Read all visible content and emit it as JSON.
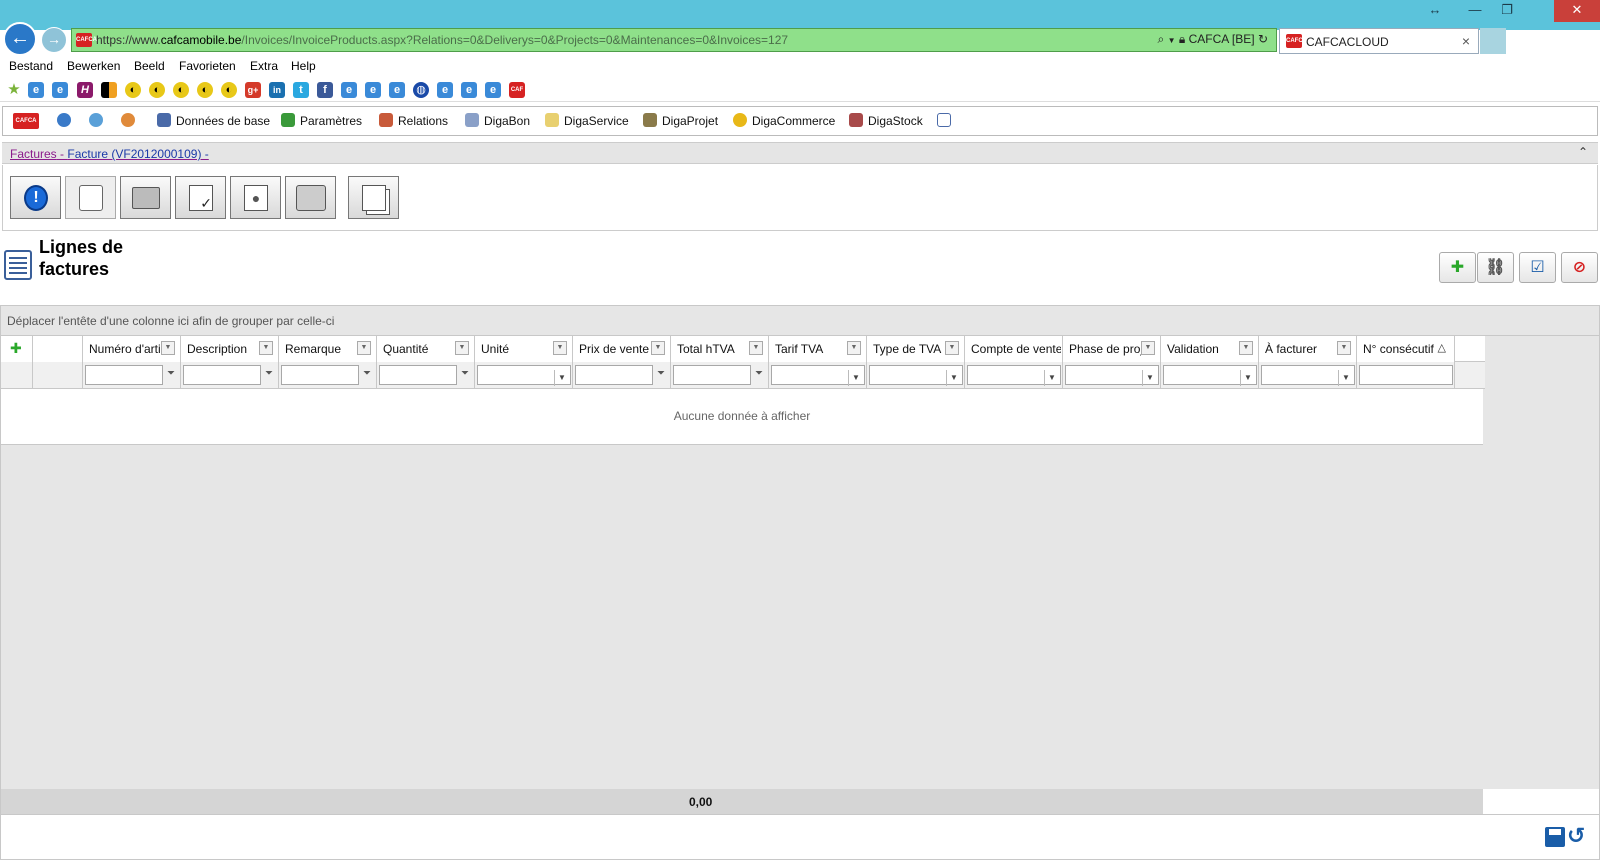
{
  "browser": {
    "url_scheme": "https://www.",
    "url_domain": "cafcamobile.be",
    "url_path": "/Invoices/InvoiceProducts.aspx?Relations=0&Deliverys=0&Projects=0&Maintenances=0&Invoices=127",
    "site_identity": "CAFCA [BE]",
    "tab_title": "CAFCACLOUD",
    "tab_close": "×",
    "back_glyph": "←",
    "forward_glyph": "→",
    "favicon_text": "CAFCA"
  },
  "menu": [
    "Bestand",
    "Bewerken",
    "Beeld",
    "Favorieten",
    "Extra",
    "Help"
  ],
  "app_toolbar": {
    "items": [
      "Données de base",
      "Paramètres",
      "Relations",
      "DigaBon",
      "DigaService",
      "DigaProjet",
      "DigaCommerce",
      "DigaStock"
    ],
    "logo_text": "CAFCA"
  },
  "breadcrumb": {
    "parent": "Factures",
    "separator": " - ",
    "current": "Facture (VF2012000109) -"
  },
  "section": {
    "title": "Lignes de factures"
  },
  "grid": {
    "group_hint": "Déplacer l'entête d'une colonne ici afin de grouper par celle-ci",
    "columns": [
      "Numéro d'article",
      "Description",
      "Remarque",
      "Quantité",
      "Unité",
      "Prix de vente",
      "Total hTVA",
      "Tarif TVA",
      "Type de TVA",
      "Compte de vente",
      "Phase de projet",
      "Validation",
      "À facturer",
      "N° consécutif"
    ],
    "sort_indicator": "△",
    "empty_text": "Aucune donnée à afficher",
    "footer_total": "0,00"
  },
  "colors": {
    "titlebar": "#5bc3db",
    "addressbar": "#8fe08a",
    "link_visited": "#8b1a8b",
    "link": "#1a3aa8",
    "accent_blue": "#1a5da8"
  }
}
